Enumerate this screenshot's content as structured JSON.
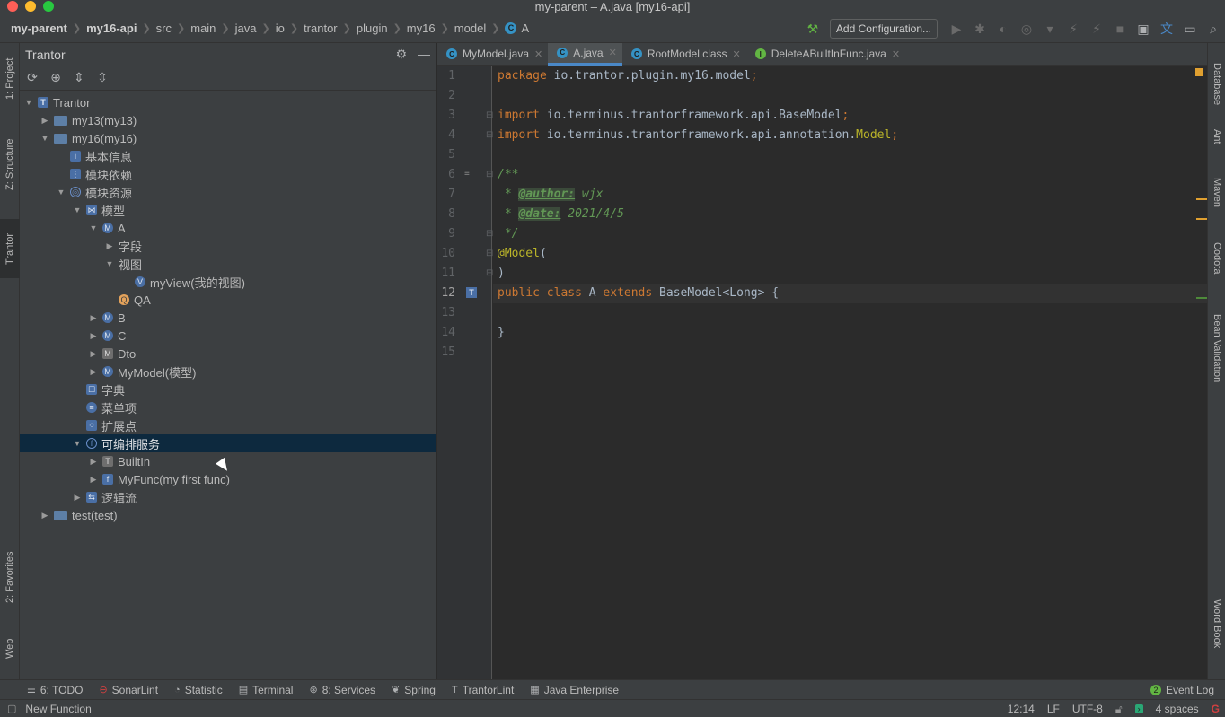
{
  "window": {
    "title": "my-parent – A.java [my16-api]"
  },
  "breadcrumbs": [
    "my-parent",
    "my16-api",
    "src",
    "main",
    "java",
    "io",
    "trantor",
    "plugin",
    "my16",
    "model",
    "A"
  ],
  "toolbar": {
    "add_configuration": "Add Configuration..."
  },
  "left_tabs": [
    "1: Project",
    "Z: Structure",
    "Trantor",
    "2: Favorites",
    "Web"
  ],
  "right_tabs": [
    "Database",
    "Ant",
    "Maven",
    "Codota",
    "Bean Validation",
    "Word Book"
  ],
  "panel": {
    "title": "Trantor",
    "tree": [
      {
        "label": "Trantor",
        "depth": 0,
        "arrow": "down",
        "icon": "trantor-icon"
      },
      {
        "label": "my13(my13)",
        "depth": 1,
        "arrow": "right",
        "icon": "folder-icon"
      },
      {
        "label": "my16(my16)",
        "depth": 1,
        "arrow": "down",
        "icon": "folder-icon"
      },
      {
        "label": "基本信息",
        "depth": 2,
        "arrow": "",
        "icon": "info-icon"
      },
      {
        "label": "模块依赖",
        "depth": 2,
        "arrow": "",
        "icon": "dependency-icon"
      },
      {
        "label": "模块资源",
        "depth": 2,
        "arrow": "down",
        "icon": "globe-icon"
      },
      {
        "label": "模型",
        "depth": 3,
        "arrow": "down",
        "icon": "model-group-icon"
      },
      {
        "label": "A",
        "depth": 4,
        "arrow": "down",
        "icon": "model-icon"
      },
      {
        "label": "字段",
        "depth": 5,
        "arrow": "right",
        "icon": ""
      },
      {
        "label": "视图",
        "depth": 5,
        "arrow": "down",
        "icon": ""
      },
      {
        "label": "myView(我的视图)",
        "depth": 6,
        "arrow": "",
        "icon": "view-icon"
      },
      {
        "label": "QA",
        "depth": 5,
        "arrow": "",
        "icon": "query-icon"
      },
      {
        "label": "B",
        "depth": 4,
        "arrow": "right",
        "icon": "model-icon"
      },
      {
        "label": "C",
        "depth": 4,
        "arrow": "right",
        "icon": "model-icon"
      },
      {
        "label": "Dto",
        "depth": 4,
        "arrow": "right",
        "icon": "dto-icon"
      },
      {
        "label": "MyModel(模型)",
        "depth": 4,
        "arrow": "right",
        "icon": "model-icon"
      },
      {
        "label": "字典",
        "depth": 3,
        "arrow": "",
        "icon": "dictionary-icon"
      },
      {
        "label": "菜单项",
        "depth": 3,
        "arrow": "",
        "icon": "menu-icon"
      },
      {
        "label": "扩展点",
        "depth": 3,
        "arrow": "",
        "icon": "extension-icon"
      },
      {
        "label": "可编排服务",
        "depth": 3,
        "arrow": "down",
        "icon": "service-icon",
        "selected": true
      },
      {
        "label": "BuiltIn",
        "depth": 4,
        "arrow": "right",
        "icon": "builtin-icon"
      },
      {
        "label": "MyFunc(my first func)",
        "depth": 4,
        "arrow": "right",
        "icon": "func-icon"
      },
      {
        "label": "逻辑流",
        "depth": 3,
        "arrow": "right",
        "icon": "flow-icon"
      },
      {
        "label": "test(test)",
        "depth": 1,
        "arrow": "right",
        "icon": "folder-icon"
      }
    ]
  },
  "editor": {
    "tabs": [
      {
        "label": "MyModel.java",
        "icon": "C",
        "active": false
      },
      {
        "label": "A.java",
        "icon": "C",
        "active": true
      },
      {
        "label": "RootModel.class",
        "icon": "C",
        "active": false
      },
      {
        "label": "DeleteABuiltInFunc.java",
        "icon": "I",
        "active": false
      }
    ],
    "lines": [
      "1",
      "2",
      "3",
      "4",
      "5",
      "6",
      "7",
      "8",
      "9",
      "10",
      "11",
      "12",
      "13",
      "14",
      "15"
    ],
    "current_line": "12",
    "code": {
      "l1": [
        "package",
        " io.trantor.plugin.my16.model",
        ";"
      ],
      "l3": [
        "import",
        " io.terminus.trantorframework.api.BaseModel",
        ";"
      ],
      "l4": [
        "import",
        " io.terminus.trantorframework.api.annotation.",
        "Model",
        ";"
      ],
      "l6": "/**",
      "l7": [
        " * ",
        "@author:",
        " wjx"
      ],
      "l8": [
        " * ",
        "@date:",
        " 2021/4/5"
      ],
      "l9": " */",
      "l10": [
        "@Model",
        "("
      ],
      "l11": ")",
      "l12": [
        "public",
        " ",
        "class",
        " A ",
        "extends",
        " BaseModel<Long> {"
      ],
      "l14": "}"
    }
  },
  "bottom_tools": [
    {
      "label": "6: TODO",
      "icon": "list-icon"
    },
    {
      "label": "SonarLint",
      "icon": "sonarlint-icon"
    },
    {
      "label": "Statistic",
      "icon": "statistic-icon"
    },
    {
      "label": "Terminal",
      "icon": "terminal-icon"
    },
    {
      "label": "8: Services",
      "icon": "services-icon"
    },
    {
      "label": "Spring",
      "icon": "spring-icon"
    },
    {
      "label": "TrantorLint",
      "icon": "trantorlint-icon"
    },
    {
      "label": "Java Enterprise",
      "icon": "java-enterprise-icon"
    }
  ],
  "event_log": {
    "count": "2",
    "label": "Event Log"
  },
  "status": {
    "message": "New Function",
    "position": "12:14",
    "line_sep": "LF",
    "encoding": "UTF-8",
    "indent": "4 spaces"
  }
}
